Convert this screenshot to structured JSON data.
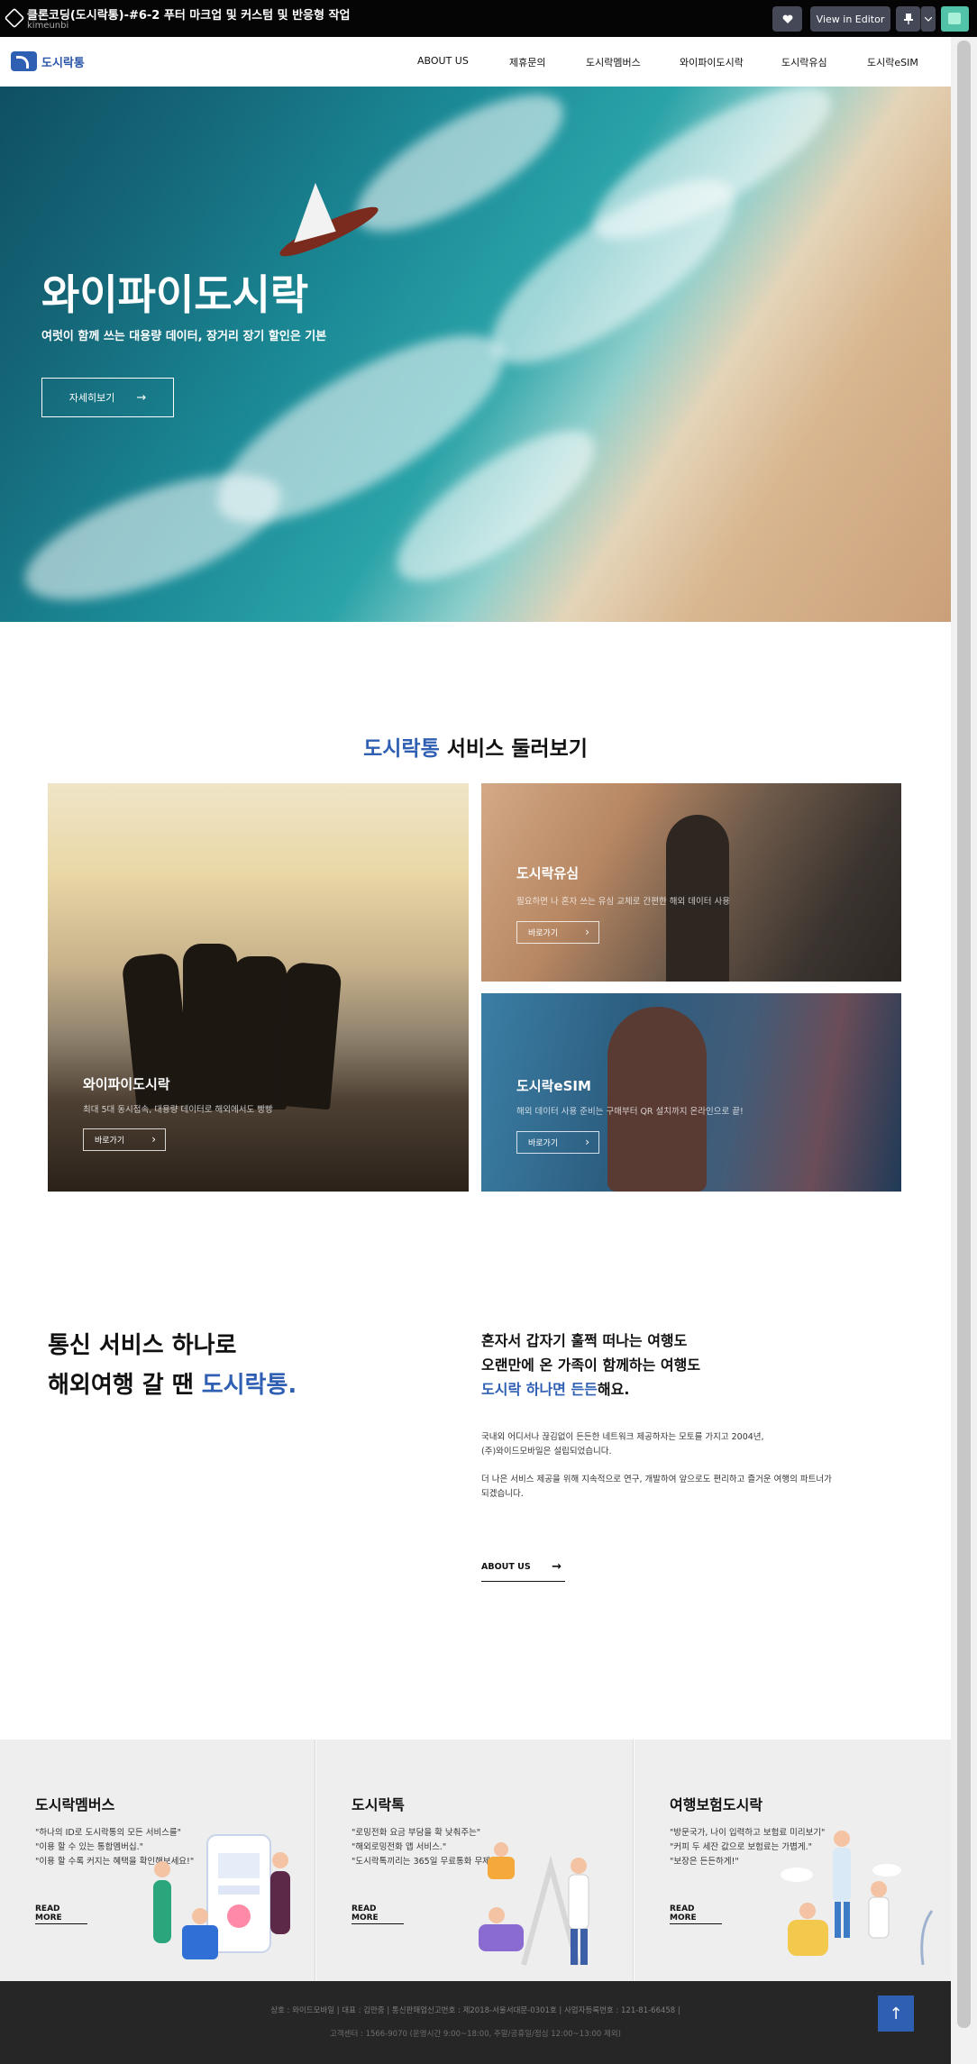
{
  "codepen": {
    "title": "클론코딩(도시락통)-#6-2 푸터 마크업 및 커스텀 및 반응형 작업",
    "user": "kimeunbi",
    "view_in_editor": "View in Editor",
    "heart_icon": "heart-icon",
    "pin_icon": "pin-icon"
  },
  "header": {
    "brand": "도시락통",
    "nav": [
      "ABOUT US",
      "제휴문의",
      "도시락멤버스",
      "와이파이도시락",
      "도시락유심",
      "도시락eSIM"
    ]
  },
  "hero": {
    "title": "와이파이도시락",
    "subtitle": "여럿이 함께 쓰는 대용량 데이터, 장거리 장기 할인은 기본",
    "button": "자세히보기",
    "arrow": "→"
  },
  "services": {
    "heading_accent": "도시락통",
    "heading_rest": " 서비스 둘러보기",
    "cards": [
      {
        "title": "와이파이도시락",
        "desc": "최대 5대 동시접속, 대용량 데이터로 해외에서도 빵빵",
        "button": "바로가기"
      },
      {
        "title": "도시락유심",
        "desc": "필요하면 나 혼자 쓰는 유심 교체로 간편한 해외 데이터 사용",
        "button": "바로가기"
      },
      {
        "title": "도시락eSIM",
        "desc": "해외 데이터 사용 준비는 구매부터 QR 설치까지 온라인으로 끝!",
        "button": "바로가기"
      }
    ],
    "arrow": "›"
  },
  "about": {
    "left_line1": "통신 서비스 하나로",
    "left_line2": "해외여행 갈 땐 ",
    "left_accent": "도시락통.",
    "right_line1": "혼자서 갑자기 훌쩍 떠나는 여행도",
    "right_line2": "오랜만에 온 가족이 함께하는 여행도",
    "right_accent": "도시락 하나면 든든",
    "right_tail": "해요.",
    "p1_line1": "국내외 어디서나 끊김없이 든든한 네트워크 제공하자는 모토를 가지고 2004년,",
    "p1_line2": "(주)와이드모바일은 설립되었습니다.",
    "p2_line1": "더 나은 서비스 제공을 위해 지속적으로 연구, 개발하여 앞으로도 편리하고 즐거운 여행의 파트너가",
    "p2_line2": "되겠습니다.",
    "link": "ABOUT US",
    "arrow": "→"
  },
  "promos": [
    {
      "title": "도시락멤버스",
      "lines": [
        "\"하나의 ID로 도시락통의 모든 서비스를\"",
        "\"이용 할 수 있는 통합멤버십.\"",
        "\"이용 할 수록 커지는 혜택을 확인해보세요!\""
      ],
      "more": "READ MORE"
    },
    {
      "title": "도시락톡",
      "lines": [
        "\"로밍전화 요금 부담을 확 낮춰주는\"",
        "\"해외로밍전화 앱 서비스.\"",
        "\"도시락톡끼리는 365일 무료통화 무제한!\""
      ],
      "more": "READ MORE"
    },
    {
      "title": "여행보험도시락",
      "lines": [
        "\"방문국가, 나이 입력하고 보험료 미리보기\"",
        "\"커피 두 세잔 값으로 보험료는 가볍게.\"",
        "\"보장은 든든하게!\""
      ],
      "more": "READ MORE"
    }
  ],
  "footer": {
    "line1": "상호 : 와이드모바일    |    대표 : 김만중    |    통신판매업신고번호 : 제2018-서울서대문-0301호    |    사업자등록번호 : 121-81-66458    |",
    "line2": "고객센터 : 1566-9070 (운영시간 9:00~18:00, 주말/공휴일/점심 12:00~13:00 제외)",
    "top_arrow": "↑"
  },
  "colors": {
    "accent": "#2f5fb3",
    "footer_bg": "#262626",
    "promo_bg": "#eeeeee"
  }
}
